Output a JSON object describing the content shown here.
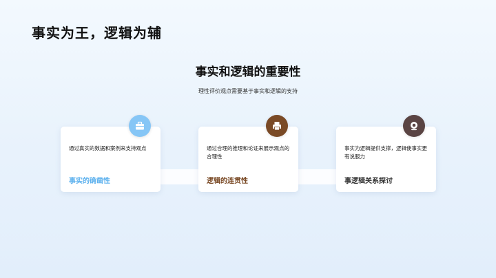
{
  "slide": {
    "title": "事实为王，逻辑为辅",
    "heading": "事实和逻辑的重要性",
    "subtitle": "理性评价观点需要基于事实和逻辑的支持"
  },
  "cards": [
    {
      "text": "通过真实的数据和案例来支持观点",
      "label": "事实的确凿性",
      "icon": "briefcase-icon",
      "badge_color": "#86c6f6",
      "label_color": "#5fb2ee"
    },
    {
      "text": "通过合理的推理和论证来展示观点的合理性",
      "label": "逻辑的连贯性",
      "icon": "printer-icon",
      "badge_color": "#7a4a26",
      "label_color": "#7a4a26"
    },
    {
      "text": "事实为逻辑提供支撑，逻辑使事实更有说服力",
      "label": "事逻辑关系探讨",
      "icon": "webcam-icon",
      "badge_color": "#5a4443",
      "label_color": "#333333"
    }
  ]
}
